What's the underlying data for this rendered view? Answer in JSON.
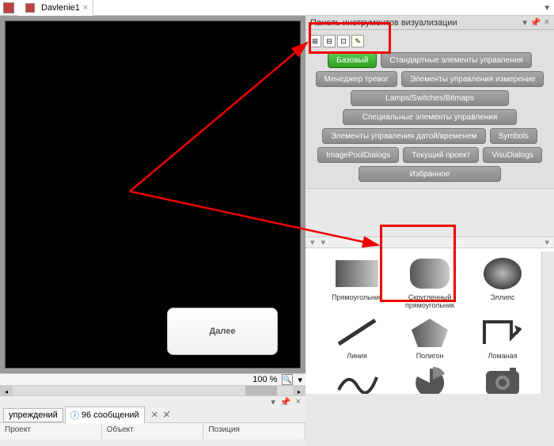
{
  "tab": {
    "title": "Davlenie1",
    "close": "×"
  },
  "canvas": {
    "button_label": "Далее",
    "zoom": "100 %"
  },
  "toolbox": {
    "title": "Панель инструментов визуализации",
    "categories": {
      "basic": "Базовый",
      "std": "Стандартные элементы управления",
      "alarm": "Менеджер тревог",
      "meas": "Элементы управления измерение",
      "lamps": "Lamps/Switches/Bitmaps",
      "special": "Специальные элементы управления",
      "datetime": "Элементы управления датой/временем",
      "symbols": "Symbols",
      "pool": "ImagePoolDialogs",
      "curproj": "Текущий проект",
      "visud": "VisuDialogs",
      "fav": "Избранное"
    },
    "shapes": {
      "rect": "Прямоугольник",
      "roundrect": "Скругленный прямоугольник",
      "ellipse": "Эллипс",
      "line": "Линия",
      "polygon": "Полигон",
      "polyline": "Ломаная",
      "bezier": "Кривая Безье",
      "pie": "Секторная диаграмма",
      "image": "Изображение"
    }
  },
  "messages": {
    "warn_tab": "упреждений",
    "msg_tab": "96 сообщений",
    "cols": {
      "proj": "Проект",
      "obj": "Объект",
      "pos": "Позиция"
    }
  }
}
